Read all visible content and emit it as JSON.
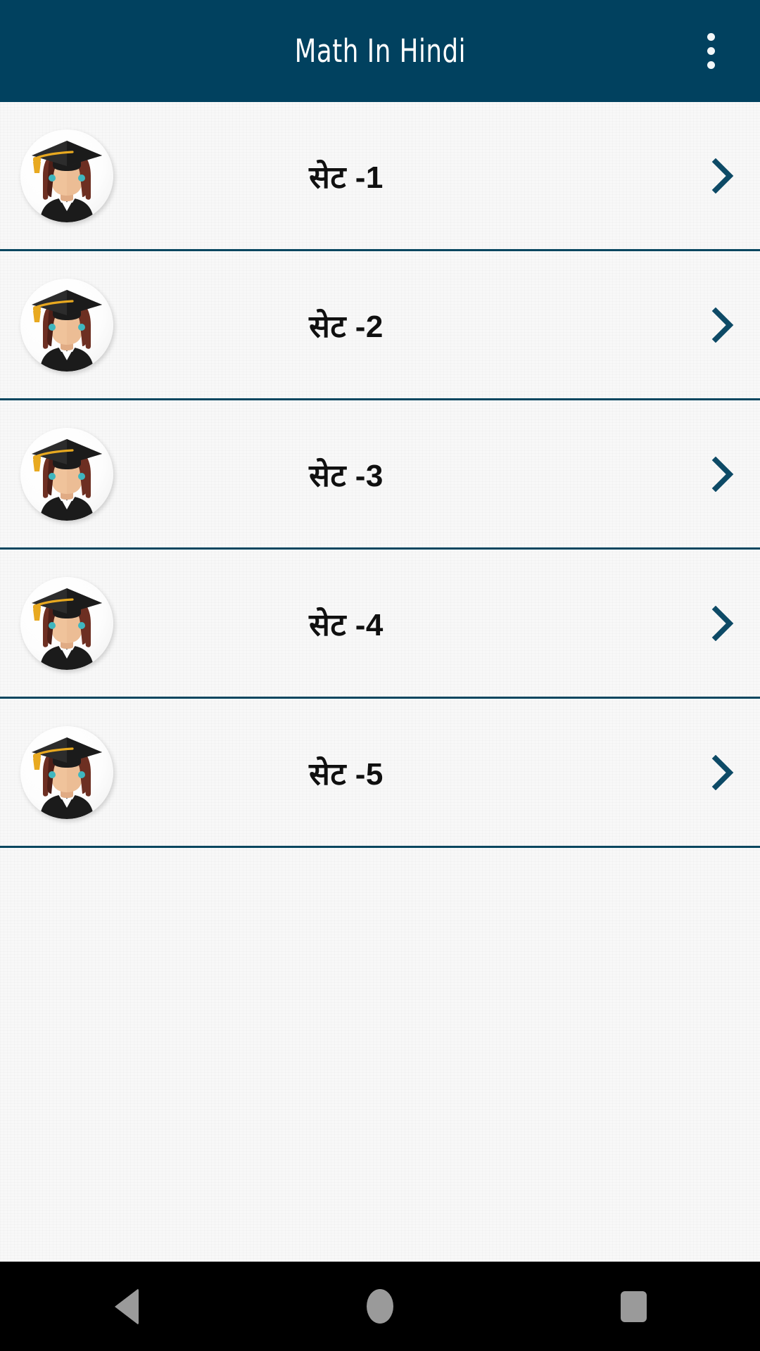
{
  "appbar": {
    "title": "Math In Hindi",
    "background_color": "#01415f",
    "title_color": "#ffffff",
    "overflow_menu_label": "More options",
    "overflow_dot_count": 3
  },
  "theme": {
    "accent_color": "#01415f",
    "divider_color": "#06465f",
    "page_background": "#f8f8f8",
    "chevron_color": "#0d4a66",
    "label_color": "#101010",
    "navbar_background": "#000000",
    "navbar_icon_color": "#9a9a9a"
  },
  "list": {
    "items": [
      {
        "label": "सेट -1",
        "avatar_icon": "graduate-avatar-icon",
        "chevron_icon": "chevron-right-icon"
      },
      {
        "label": "सेट -2",
        "avatar_icon": "graduate-avatar-icon",
        "chevron_icon": "chevron-right-icon"
      },
      {
        "label": "सेट -3",
        "avatar_icon": "graduate-avatar-icon",
        "chevron_icon": "chevron-right-icon"
      },
      {
        "label": "सेट -4",
        "avatar_icon": "graduate-avatar-icon",
        "chevron_icon": "chevron-right-icon"
      },
      {
        "label": "सेट -5",
        "avatar_icon": "graduate-avatar-icon",
        "chevron_icon": "chevron-right-icon"
      }
    ]
  },
  "navbar": {
    "back_label": "Back",
    "home_label": "Home",
    "recents_label": "Recents"
  },
  "avatar_palette": {
    "cap": "#1b1b1b",
    "cap_top": "#2c2c2c",
    "tassel": "#e8a920",
    "hair": "#6d2f22",
    "hair_dark": "#4e1f17",
    "skin": "#f0c39b",
    "skin_shade": "#e0ab84",
    "gown": "#1b1b1b",
    "collar": "#ffffff",
    "earring": "#3fb6bf",
    "disc": "#fafafa"
  }
}
